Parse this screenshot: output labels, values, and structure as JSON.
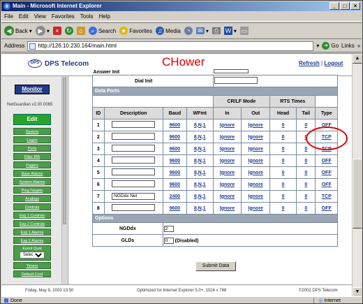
{
  "window": {
    "title": "Main - Microsoft Internet Explorer",
    "min": "_",
    "max": "□",
    "close": "×"
  },
  "menu": [
    "File",
    "Edit",
    "View",
    "Favorites",
    "Tools",
    "Help"
  ],
  "toolbar": {
    "back": "Back",
    "search": "Search",
    "favorites": "Favorites",
    "media": "Media"
  },
  "address": {
    "label": "Address",
    "url": "http://126.10.230.164/main.html",
    "go": "Go",
    "links": "Links"
  },
  "header": {
    "logo": "DPS Telecom",
    "logo_mark": "DPS",
    "user": "CHower",
    "refresh": "Refresh",
    "sep": " | ",
    "logout": "Logout"
  },
  "nav": {
    "monitor": "Monitor",
    "version": "NetGuardian v2.00.0065",
    "edit": "Edit",
    "items": [
      "System",
      "Logon",
      "Ports",
      "Filter IPA",
      "Pagers",
      "Base Alarms",
      "System Alarms",
      "Ping Targets",
      "Analogs",
      "Controls",
      "Exp 1 Controls",
      "Exp 2 Controls",
      "Exp 1 Alarms",
      "Exp 2 Alarms"
    ],
    "event_qual": "Event Qual",
    "event_select": "Select",
    "more": [
      "Timers",
      "Default Conf"
    ]
  },
  "main": {
    "answer_init_label": "Answer Init",
    "dial_init_label": "Dial Init",
    "data_ports_title": "Data Ports",
    "headers": {
      "crlf": "CR/LF Mode",
      "rts": "RTS Times",
      "id": "ID",
      "description": "Description",
      "baud": "Baud",
      "wfmt": "WFmt",
      "in": "In",
      "out": "Out",
      "head": "Head",
      "tail": "Tail",
      "type": "Type"
    },
    "rows": [
      {
        "id": "1",
        "desc": "",
        "baud": "9600",
        "wfmt": "8,N,1",
        "in": "Ignore",
        "out": "Ignore",
        "head": "0",
        "tail": "0",
        "type": "OFF"
      },
      {
        "id": "2",
        "desc": "",
        "baud": "9600",
        "wfmt": "8,N,1",
        "in": "Ignore",
        "out": "Ignore",
        "head": "0",
        "tail": "0",
        "type": "TCP"
      },
      {
        "id": "3",
        "desc": "",
        "baud": "9600",
        "wfmt": "8,N,1",
        "in": "Ignore",
        "out": "Ignore",
        "head": "0",
        "tail": "0",
        "type": "TCP"
      },
      {
        "id": "4",
        "desc": "",
        "baud": "9600",
        "wfmt": "8,N,1",
        "in": "Ignore",
        "out": "Ignore",
        "head": "0",
        "tail": "0",
        "type": "OFF"
      },
      {
        "id": "5",
        "desc": "",
        "baud": "9600",
        "wfmt": "8,N,1",
        "in": "Ignore",
        "out": "Ignore",
        "head": "0",
        "tail": "0",
        "type": "OFF"
      },
      {
        "id": "6",
        "desc": "",
        "baud": "9600",
        "wfmt": "8,N,1",
        "in": "Ignore",
        "out": "Ignore",
        "head": "0",
        "tail": "0",
        "type": "OFF"
      },
      {
        "id": "7",
        "desc": "NGDdx Net",
        "baud": "2400",
        "wfmt": "8,N,1",
        "in": "Ignore",
        "out": "Ignore",
        "head": "0",
        "tail": "0",
        "type": "TCP"
      },
      {
        "id": "8",
        "desc": "",
        "baud": "9600",
        "wfmt": "8,N,1",
        "in": "Ignore",
        "out": "Ignore",
        "head": "0",
        "tail": "0",
        "type": "OFF"
      }
    ],
    "options_title": "Options",
    "ngddx_label": "NGDdx",
    "ngddx_value": "2",
    "glds_label": "GLDs",
    "glds_value": "0",
    "glds_note": "(Disabled)",
    "submit": "Submit Data"
  },
  "footer": {
    "date": "Friday, May 9, 2003   13:50",
    "optimized": "Optimized for Internet Explorer 5.0+, 1024 x 768",
    "copyright": "©2002 DPS Telecom"
  },
  "status": {
    "left": "Done",
    "zone": "Internet"
  },
  "colors": {
    "accent": "#1f3a8a",
    "user": "#e00000",
    "nav_green": "#4c9c4c",
    "annotation": "#e00000"
  }
}
